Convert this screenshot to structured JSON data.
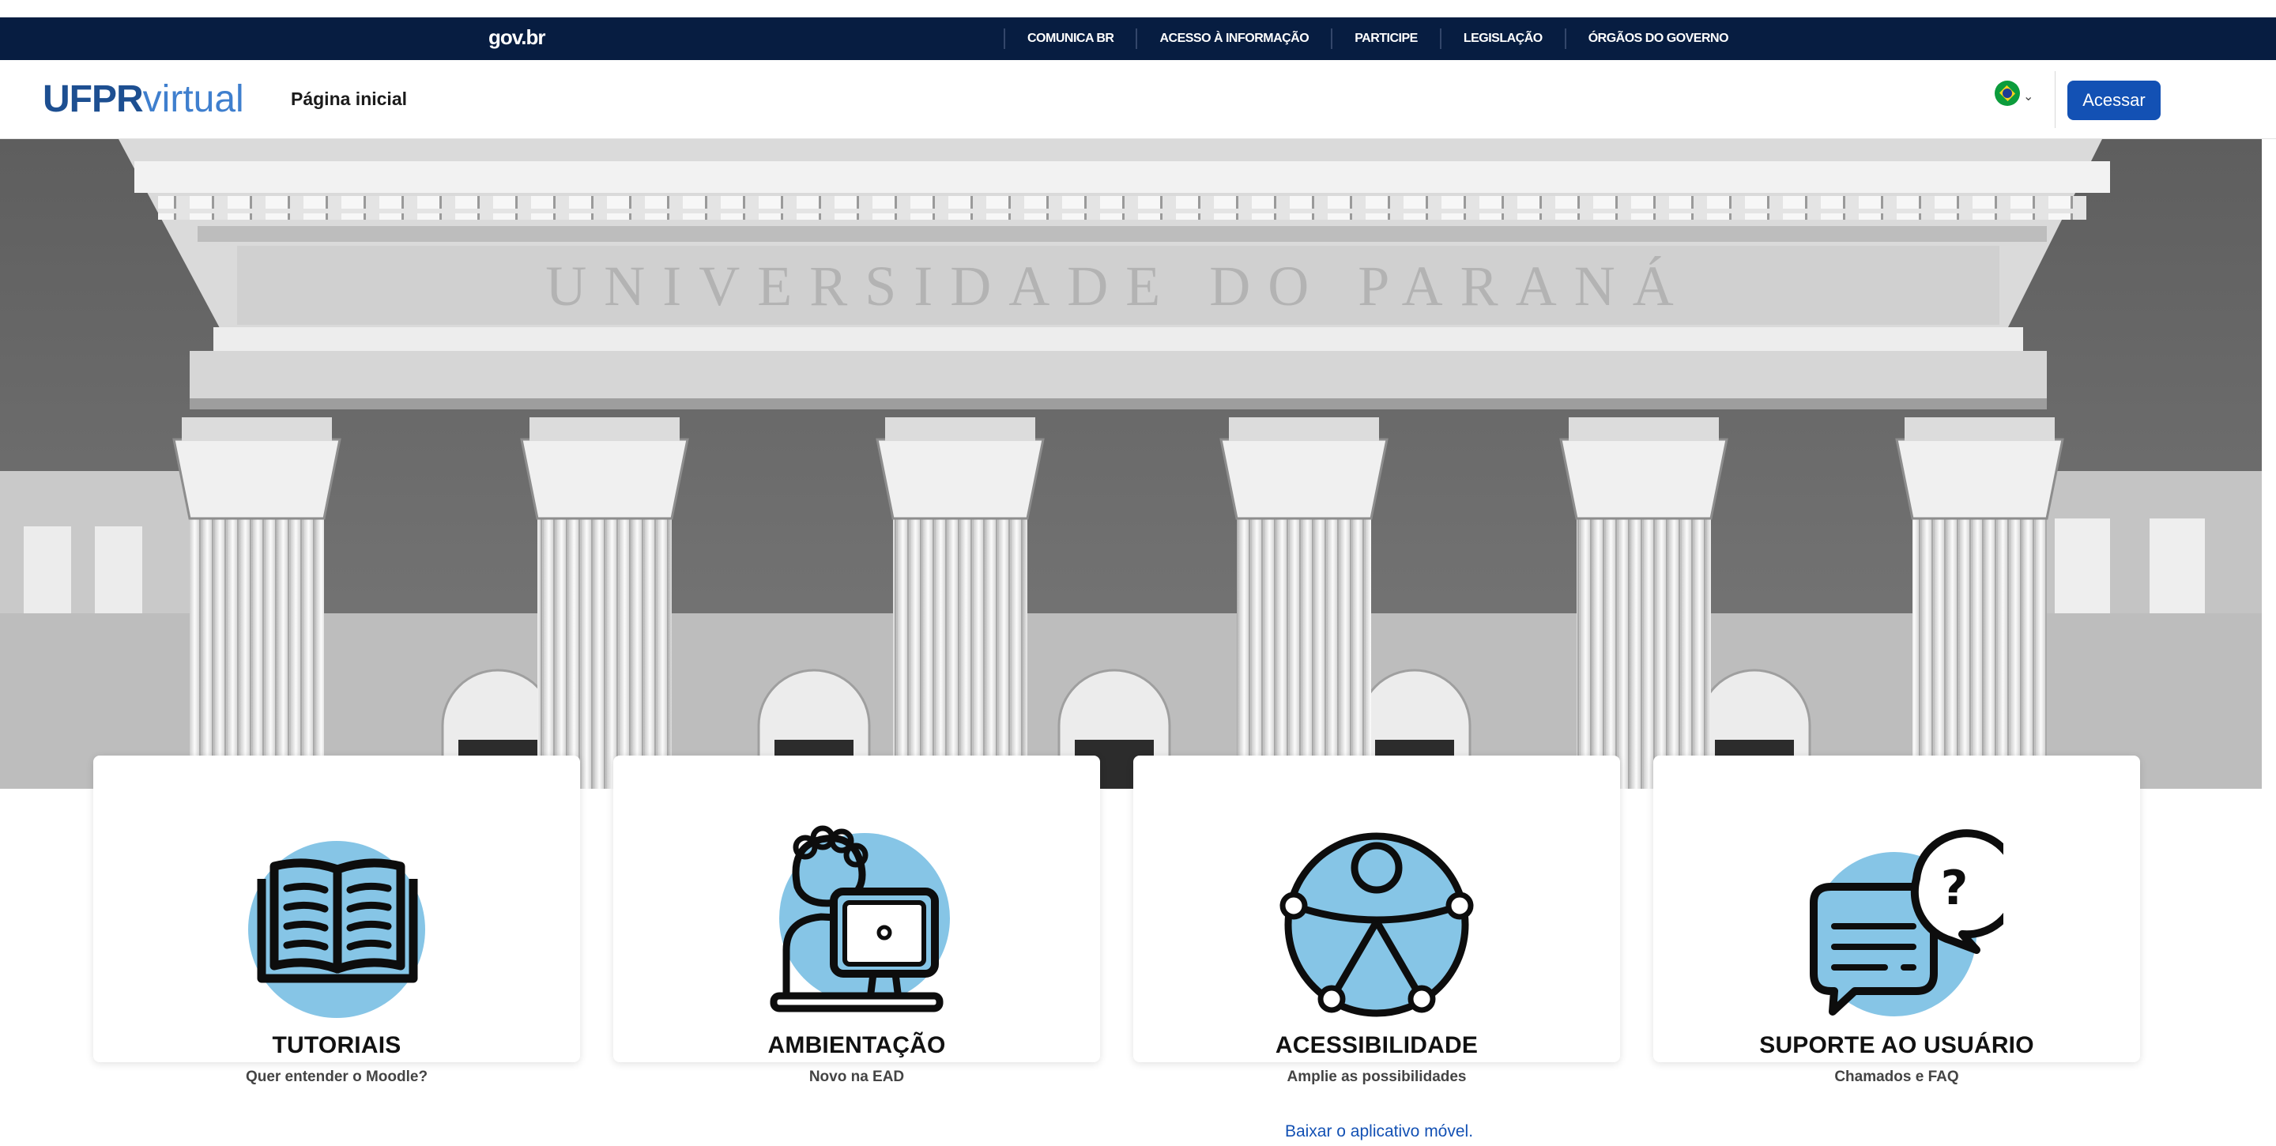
{
  "govbar": {
    "logo": "gov.br",
    "links": [
      "COMUNICA BR",
      "ACESSO À INFORMAÇÃO",
      "PARTICIPE",
      "LEGISLAÇÃO",
      "ÓRGÃOS DO GOVERNO"
    ]
  },
  "navbar": {
    "brand_bold": "UFPR",
    "brand_light": "virtual",
    "home_label": "Página inicial",
    "language_icon": "brazil-flag-icon",
    "login_label": "Acessar"
  },
  "hero": {
    "inscription": "UNIVERSIDADE DO PARANÁ"
  },
  "cards": [
    {
      "title": "TUTORIAIS",
      "subtitle": "Quer entender o Moodle?",
      "icon": "open-book-icon"
    },
    {
      "title": "AMBIENTAÇÃO",
      "subtitle": "Novo na EAD",
      "icon": "student-computer-icon"
    },
    {
      "title": "ACESSIBILIDADE",
      "subtitle": "Amplie as possibilidades",
      "icon": "accessibility-icon"
    },
    {
      "title": "SUPORTE AO USUÁRIO",
      "subtitle": "Chamados e FAQ",
      "icon": "chat-help-icon"
    }
  ],
  "footer": {
    "app_link": "Baixar o aplicativo móvel."
  },
  "colors": {
    "gov_bar": "#071d41",
    "primary": "#1351b4",
    "brand_dark": "#1d4f91",
    "brand_light": "#3f7fce",
    "icon_fill": "#86c5e6"
  }
}
